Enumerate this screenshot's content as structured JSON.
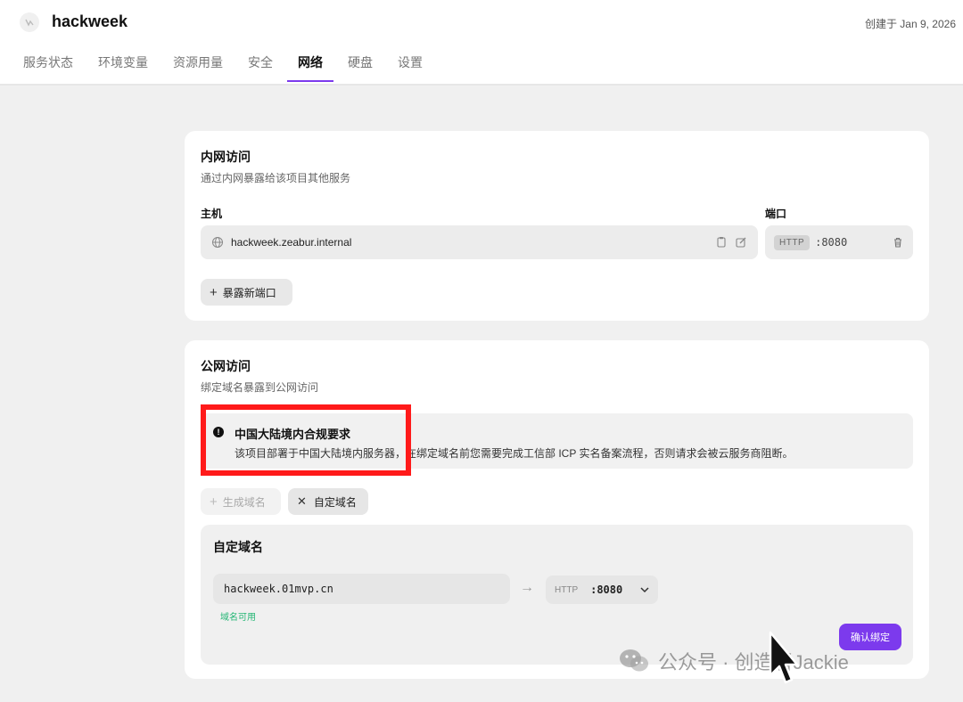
{
  "header": {
    "project_name": "hackweek",
    "created_at": "创建于 Jan 9, 2026"
  },
  "tabs": [
    {
      "label": "服务状态",
      "active": false
    },
    {
      "label": "环境变量",
      "active": false
    },
    {
      "label": "资源用量",
      "active": false
    },
    {
      "label": "安全",
      "active": false
    },
    {
      "label": "网络",
      "active": true
    },
    {
      "label": "硬盘",
      "active": false
    },
    {
      "label": "设置",
      "active": false
    }
  ],
  "internal": {
    "title": "内网访问",
    "subtitle": "通过内网暴露给该项目其他服务",
    "host_label": "主机",
    "host_value": "hackweek.zeabur.internal",
    "port_label": "端口",
    "port_protocol": "HTTP",
    "port_value": ":8080",
    "expose_button": "暴露新端口"
  },
  "public": {
    "title": "公网访问",
    "subtitle": "绑定域名暴露到公网访问",
    "notice_title": "中国大陆境内合规要求",
    "notice_body": "该项目部署于中国大陆境内服务器，在绑定域名前您需要完成工信部 ICP 实名备案流程，否则请求会被云服务商阻断。",
    "generate_button": "生成域名",
    "custom_button": "自定域名",
    "custom_panel_title": "自定域名",
    "domain_value": "hackweek.01mvp.cn",
    "domain_status": "域名可用",
    "target_protocol": "HTTP",
    "target_port": ":8080",
    "confirm_button": "确认绑定"
  },
  "watermark": {
    "text": "公众号 · 创造者Jackie"
  },
  "colors": {
    "accent": "#7c3aed",
    "highlight": "#ff1a1a",
    "success": "#22b573"
  }
}
